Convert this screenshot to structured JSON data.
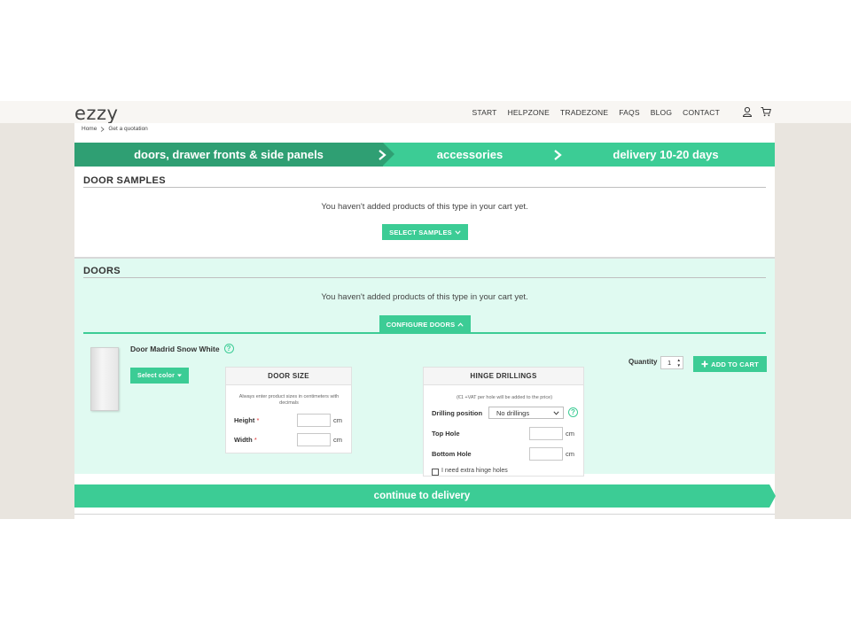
{
  "header": {
    "logo": "ezzy",
    "nav": [
      "START",
      "HELPZONE",
      "TRADEZONE",
      "FAQS",
      "BLOG",
      "CONTACT"
    ],
    "icons": [
      "user-icon",
      "cart-icon"
    ]
  },
  "breadcrumb": {
    "home": "Home",
    "current": "Get a quotation"
  },
  "steps": [
    {
      "label": "doors, drawer fronts & side panels",
      "active": true
    },
    {
      "label": "accessories",
      "active": false
    },
    {
      "label": "delivery 10-20 days",
      "active": false
    }
  ],
  "door_samples": {
    "title": "DOOR SAMPLES",
    "empty_message": "You haven't added products of this type in your cart yet.",
    "button": "SELECT SAMPLES"
  },
  "doors": {
    "title": "DOORS",
    "empty_message": "You haven't added products of this type in your cart yet.",
    "configure_button": "CONFIGURE DOORS",
    "product_name": "Door Madrid Snow White",
    "select_color": "Select color",
    "door_size": {
      "title": "DOOR SIZE",
      "note": "Always enter product sizes in centimeters with decimals",
      "height_label": "Height",
      "width_label": "Width",
      "required_mark": "*",
      "unit": "cm"
    },
    "hinge": {
      "title": "HINGE DRILLINGS",
      "note": "(€1 +VAT per hole will be added to the price)",
      "drilling_position_label": "Drilling position",
      "drilling_position_value": "No drillings",
      "top_hole_label": "Top Hole",
      "bottom_hole_label": "Bottom Hole",
      "unit": "cm",
      "extra_label": "I need extra hinge holes"
    },
    "quantity_label": "Quantity",
    "quantity_value": "1",
    "add_to_cart": "ADD TO CART"
  },
  "continue_button": "continue to delivery",
  "colors": {
    "brand": "#3ccc95",
    "brand_dark": "#2f9f73",
    "section_tint": "#e0faf1"
  }
}
